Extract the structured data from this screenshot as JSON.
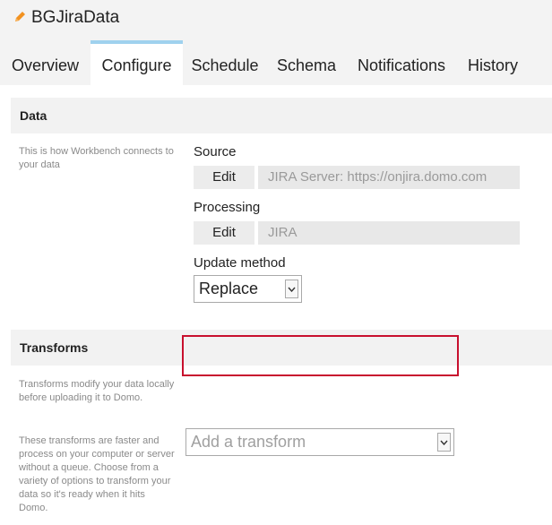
{
  "window": {
    "title": "BGJiraData",
    "title_icon": "pencil-icon",
    "accent_color": "#f29220"
  },
  "tabs": [
    {
      "label": "Overview",
      "active": false
    },
    {
      "label": "Configure",
      "active": true
    },
    {
      "label": "Schedule",
      "active": false
    },
    {
      "label": "Schema",
      "active": false
    },
    {
      "label": "Notifications",
      "active": false
    },
    {
      "label": "History",
      "active": false
    }
  ],
  "data_section": {
    "heading": "Data",
    "description": "This is how Workbench connects to your data",
    "source": {
      "label": "Source",
      "edit_label": "Edit",
      "value": "JIRA Server: https://onjira.domo.com"
    },
    "processing": {
      "label": "Processing",
      "edit_label": "Edit",
      "value": "JIRA"
    },
    "update_method": {
      "label": "Update method",
      "selected": "Replace"
    }
  },
  "transforms_section": {
    "heading": "Transforms",
    "description_1": "Transforms modify your data locally before uploading it to Domo.",
    "description_2": "These transforms are faster and process on your computer or server without a queue. Choose from a variety of options to transform your data so it's ready when it hits Domo.",
    "add_transform_placeholder": "Add a transform",
    "highlight_color": "#c8102e"
  }
}
